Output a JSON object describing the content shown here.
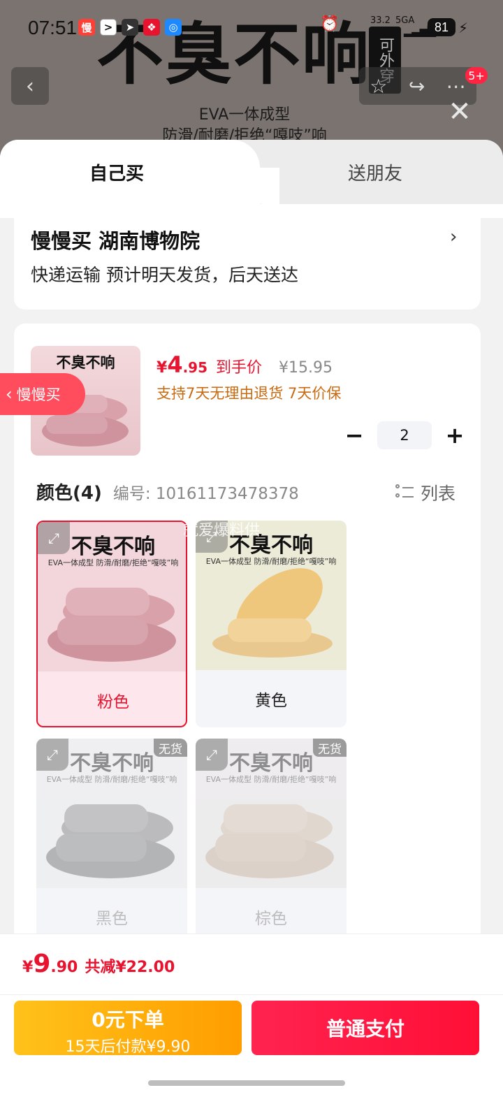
{
  "status_bar": {
    "time": "07:51",
    "net_speed": "33.2",
    "net_type": "5GA",
    "battery": "81"
  },
  "banner": {
    "title": "不臭不响",
    "seal": "可外穿",
    "sub1": "EVA一体成型",
    "sub2": "防滑/耐磨/拒绝“嘎吱”响"
  },
  "nav": {
    "badge": "5+"
  },
  "tabs": {
    "self": "自己买",
    "gift": "送朋友"
  },
  "address": {
    "title": "慢慢买  湖南博物院",
    "subtitle": "快递运输 预计明天发货，后天送达"
  },
  "product": {
    "thumb_title": "不臭不响",
    "price_currency": "¥",
    "price_int": "4",
    "price_dec": ".95",
    "price_label": "到手价",
    "original_price": "¥15.95",
    "promo": "支持7天无理由退货 7天价保",
    "quantity": "2"
  },
  "float_tag": "慢慢买",
  "colors": {
    "title": "颜色(4)",
    "code": "编号: 10161173478378",
    "list_label": "列表",
    "watermark": "就爱爆料供",
    "sold_out": "无货",
    "items": [
      {
        "name": "粉色",
        "title": "不臭不响",
        "sub": "EVA一体成型  防滑/耐磨/拒绝“嘎吱”响",
        "color": "#e8b9c0"
      },
      {
        "name": "黄色",
        "title": "不臭不响",
        "sub": "EVA一体成型  防滑/耐磨/拒绝“嘎吱”响",
        "color": "#f3cf8a"
      },
      {
        "name": "黑色",
        "title": "不臭不响",
        "sub": "EVA一体成型  防滑/耐磨/拒绝“嘎吱”响",
        "color": "#4a4a4a"
      },
      {
        "name": "棕色",
        "title": "不臭不响",
        "sub": "EVA一体成型  防滑/耐磨/拒绝“嘎吱”响",
        "color": "#b79f88"
      }
    ]
  },
  "bottom": {
    "total_currency": "¥",
    "total_int": "9",
    "total_dec": ".90",
    "total_saving": "共减¥22.00",
    "zero_line1": "0元下单",
    "zero_line2": "15天后付款¥9.90",
    "pay_label": "普通支付"
  }
}
